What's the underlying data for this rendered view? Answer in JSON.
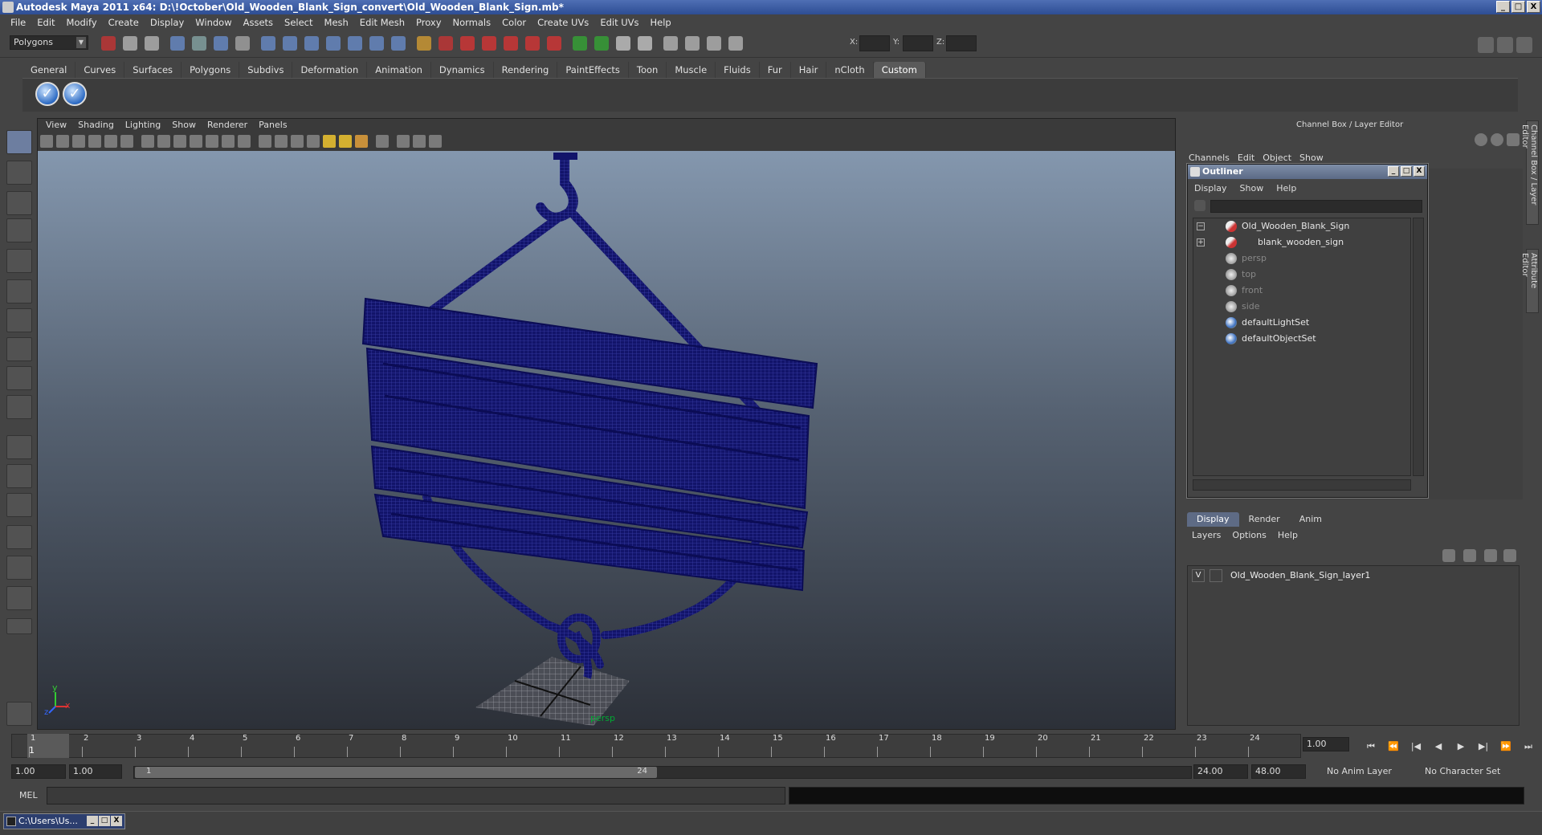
{
  "window": {
    "title": "Autodesk Maya 2011 x64: D:\\!October\\Old_Wooden_Blank_Sign_convert\\Old_Wooden_Blank_Sign.mb*",
    "min": "_",
    "max": "□",
    "close": "X"
  },
  "menubar": [
    "File",
    "Edit",
    "Modify",
    "Create",
    "Display",
    "Window",
    "Assets",
    "Select",
    "Mesh",
    "Edit Mesh",
    "Proxy",
    "Normals",
    "Color",
    "Create UVs",
    "Edit UVs",
    "Help"
  ],
  "statusline": {
    "mode": "Polygons",
    "x_label": "X:",
    "y_label": "Y:",
    "z_label": "Z:"
  },
  "shelf": {
    "tabs": [
      "General",
      "Curves",
      "Surfaces",
      "Polygons",
      "Subdivs",
      "Deformation",
      "Animation",
      "Dynamics",
      "Rendering",
      "PaintEffects",
      "Toon",
      "Muscle",
      "Fluids",
      "Fur",
      "Hair",
      "nCloth",
      "Custom"
    ],
    "active_tab": "Custom",
    "check_glyph": "✓"
  },
  "viewport": {
    "menu": [
      "View",
      "Shading",
      "Lighting",
      "Show",
      "Renderer",
      "Panels"
    ],
    "camera": "persp",
    "axis_y": "y",
    "axis_x": "x",
    "axis_z": "z",
    "wire_color": "#0e0f6e"
  },
  "channelbox": {
    "title": "Channel Box / Layer Editor",
    "menu": [
      "Channels",
      "Edit",
      "Object",
      "Show"
    ],
    "side_tabs": [
      "Channel Box / Layer Editor",
      "Attribute Editor"
    ]
  },
  "outliner": {
    "title": "Outliner",
    "menu": [
      "Display",
      "Show",
      "Help"
    ],
    "collapse_glyph": "−",
    "expand_glyph": "+",
    "items": [
      {
        "label": "Old_Wooden_Blank_Sign",
        "dim": false
      },
      {
        "label": "blank_wooden_sign",
        "dim": false
      },
      {
        "label": "persp",
        "dim": true
      },
      {
        "label": "top",
        "dim": true
      },
      {
        "label": "front",
        "dim": true
      },
      {
        "label": "side",
        "dim": true
      },
      {
        "label": "defaultLightSet",
        "dim": false
      },
      {
        "label": "defaultObjectSet",
        "dim": false
      }
    ]
  },
  "layers": {
    "tabs": [
      "Display",
      "Render",
      "Anim"
    ],
    "active_tab": "Display",
    "menu": [
      "Layers",
      "Options",
      "Help"
    ],
    "rows": [
      {
        "v": "V",
        "name": "Old_Wooden_Blank_Sign_layer1"
      }
    ]
  },
  "timeline": {
    "ticks": [
      "1",
      "2",
      "3",
      "4",
      "5",
      "6",
      "7",
      "8",
      "9",
      "10",
      "11",
      "12",
      "13",
      "14",
      "15",
      "16",
      "17",
      "18",
      "19",
      "20",
      "21",
      "22",
      "23",
      "24"
    ],
    "current_frame": "1",
    "current_field": "1.00",
    "play_controls": [
      "⏮",
      "⏪",
      "|◀",
      "◀",
      "▶",
      "▶|",
      "⏩",
      "⏭"
    ]
  },
  "range": {
    "start": "1.00",
    "playback_start": "1.00",
    "handle_start": "1",
    "handle_end": "24",
    "playback_end": "24.00",
    "end": "48.00",
    "anim_layer": "No Anim Layer",
    "char_set": "No Character Set"
  },
  "commandline": {
    "label": "MEL"
  },
  "taskbar": {
    "item": "C:\\Users\\Us..."
  }
}
